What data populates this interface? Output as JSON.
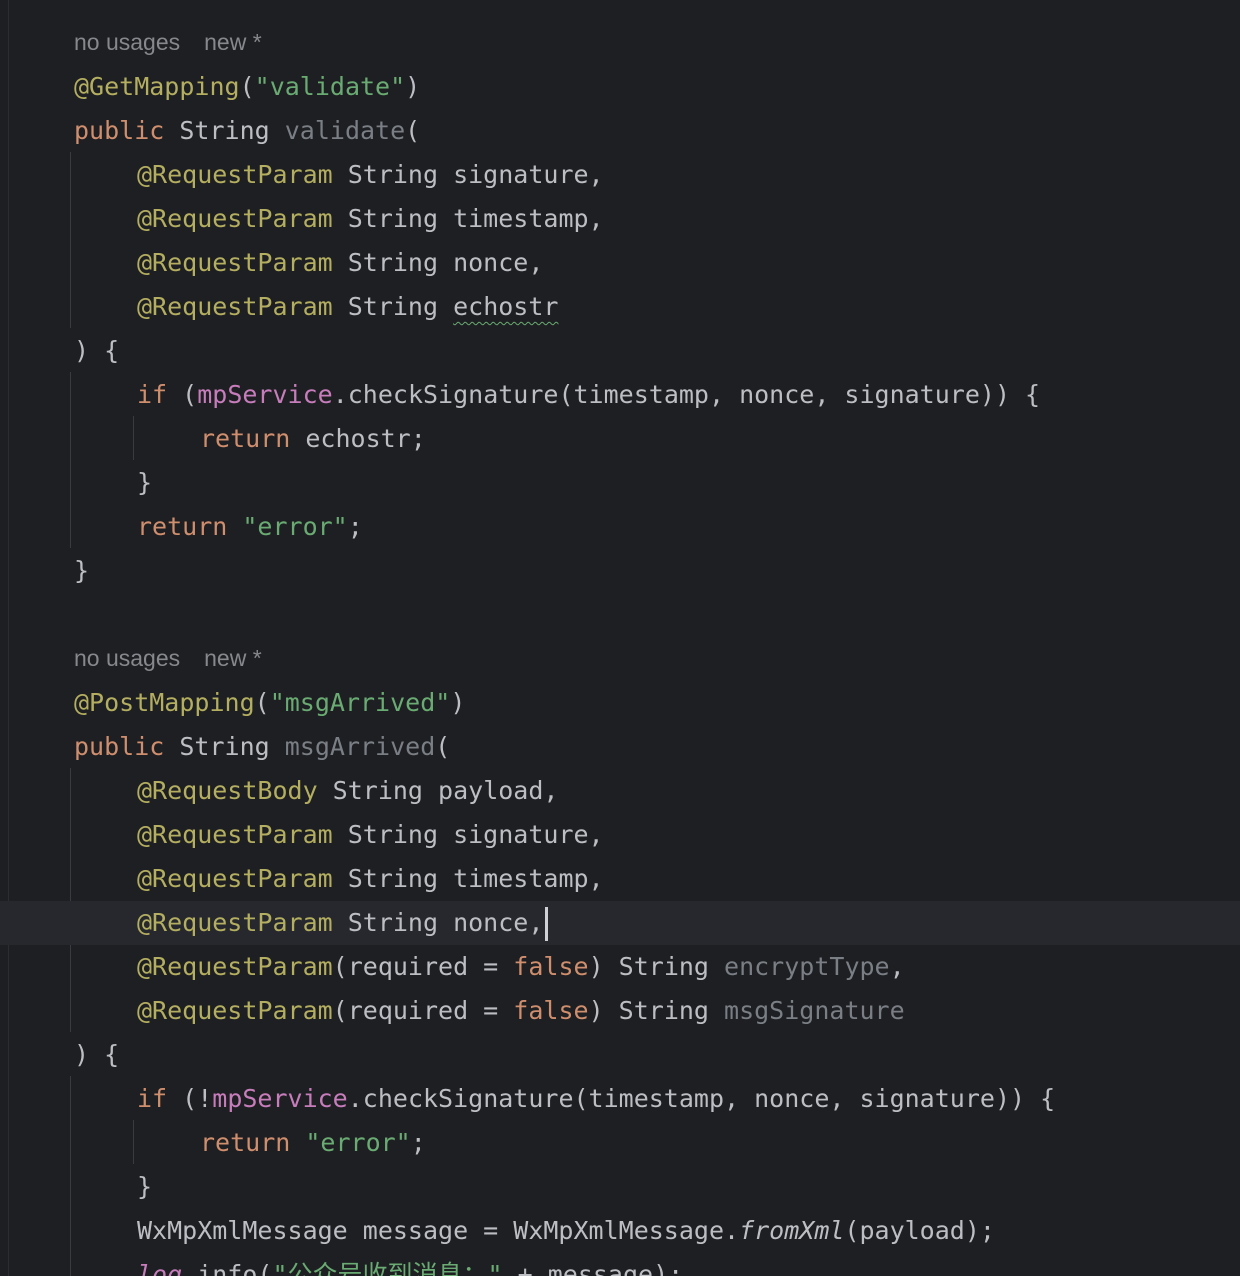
{
  "editor": {
    "hint1": {
      "usages": "no usages",
      "author": "new *"
    },
    "hint2": {
      "usages": "no usages",
      "author": "new *"
    },
    "m1": {
      "ann": "@GetMapping",
      "ann_open": "(",
      "path": "\"validate\"",
      "ann_close": ")",
      "public_kw": "public",
      "ret": " String ",
      "name": "validate",
      "open": "(",
      "p1_ann": "@RequestParam",
      "p1_rest": " String signature,",
      "p2_ann": "@RequestParam",
      "p2_rest": " String timestamp,",
      "p3_ann": "@RequestParam",
      "p3_rest": " String nonce,",
      "p4_ann": "@RequestParam",
      "p4_type": " String ",
      "p4_name": "echostr",
      "close_open": ") {",
      "if_kw": "if",
      "if_open": " (",
      "if_field": "mpService",
      "if_call": ".checkSignature(timestamp, nonce, signature)) {",
      "ret_kw": "return",
      "ret_val": " echostr;",
      "close_if": "}",
      "ret2_kw": "return",
      "ret2_sp": " ",
      "ret2_str": "\"error\"",
      "ret2_semi": ";",
      "close": "}"
    },
    "m2": {
      "ann": "@PostMapping",
      "ann_open": "(",
      "path": "\"msgArrived\"",
      "ann_close": ")",
      "public_kw": "public",
      "ret": " String ",
      "name": "msgArrived",
      "open": "(",
      "p1_ann": "@RequestBody",
      "p1_rest": " String payload,",
      "p2_ann": "@RequestParam",
      "p2_rest": " String signature,",
      "p3_ann": "@RequestParam",
      "p3_rest": " String timestamp,",
      "p4_ann": "@RequestParam",
      "p4_rest": " String nonce,",
      "p5_ann": "@RequestParam",
      "p5_mid": "(required = ",
      "p5_false": "false",
      "p5_type": ") String ",
      "p5_name": "encryptType",
      "p5_comma": ",",
      "p6_ann": "@RequestParam",
      "p6_mid": "(required = ",
      "p6_false": "false",
      "p6_type": ") String ",
      "p6_name": "msgSignature",
      "close_open": ") {",
      "if_kw": "if",
      "if_open": " (!",
      "if_field": "mpService",
      "if_call": ".checkSignature(timestamp, nonce, signature)) {",
      "ret_kw": "return",
      "ret_sp": " ",
      "ret_str": "\"error\"",
      "ret_semi": ";",
      "close_if": "}",
      "msg_a": "WxMpXmlMessage message = WxMpXmlMessage.",
      "msg_method": "fromXml",
      "msg_b": "(payload);",
      "log_field": "log",
      "log_call": ".info(",
      "log_str": "\"公众号收到消息：\"",
      "log_rest": " + message);"
    }
  }
}
